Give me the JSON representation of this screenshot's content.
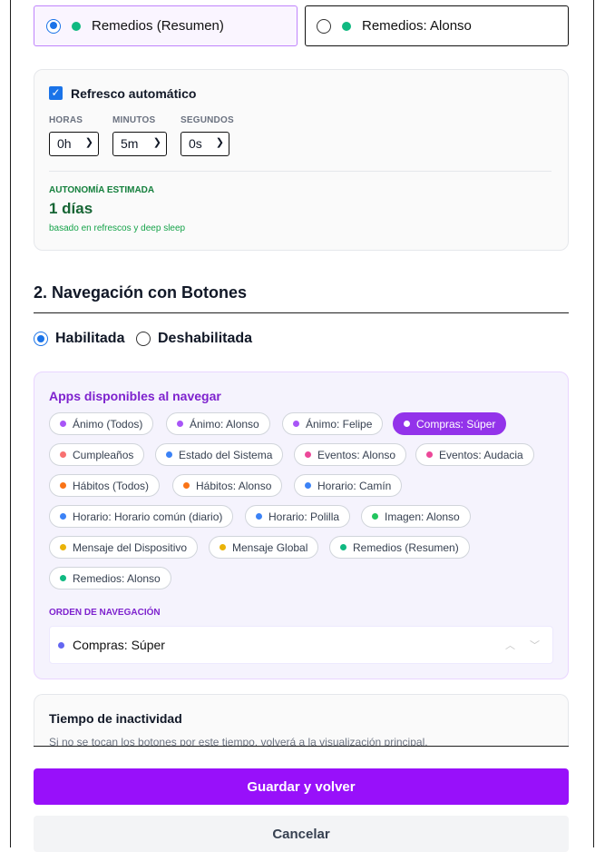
{
  "sources": [
    {
      "label": "Remedios (Resumen)",
      "selected": true,
      "dot_color": "#10b981"
    },
    {
      "label": "Remedios: Alonso",
      "selected": false,
      "dot_color": "#10b981"
    }
  ],
  "refresh": {
    "checkbox_label": "Refresco automático",
    "checked": true,
    "hours_label": "HORAS",
    "hours_value": "0h",
    "minutes_label": "MINUTOS",
    "minutes_value": "5m",
    "seconds_label": "SEGUNDOS",
    "seconds_value": "0s",
    "autonomy_label": "AUTONOMÍA ESTIMADA",
    "autonomy_value": "1 días",
    "autonomy_note": "basado en refrescos y deep sleep"
  },
  "navigation": {
    "title": "2. Navegación con Botones",
    "enabled_label": "Habilitada",
    "disabled_label": "Deshabilitada",
    "enabled": true,
    "apps_title": "Apps disponibles al navegar",
    "apps": [
      {
        "label": "Ánimo (Todos)",
        "color": "#a855f7",
        "active": false
      },
      {
        "label": "Ánimo: Alonso",
        "color": "#a855f7",
        "active": false
      },
      {
        "label": "Ánimo: Felipe",
        "color": "#a855f7",
        "active": false
      },
      {
        "label": "Compras: Súper",
        "color": "#ffffff",
        "active": true
      },
      {
        "label": "Cumpleaños",
        "color": "#f87171",
        "active": false
      },
      {
        "label": "Estado del Sistema",
        "color": "#3b82f6",
        "active": false
      },
      {
        "label": "Eventos: Alonso",
        "color": "#ec4899",
        "active": false
      },
      {
        "label": "Eventos: Audacia",
        "color": "#ec4899",
        "active": false
      },
      {
        "label": "Hábitos (Todos)",
        "color": "#f97316",
        "active": false
      },
      {
        "label": "Hábitos: Alonso",
        "color": "#f97316",
        "active": false
      },
      {
        "label": "Horario: Camín",
        "color": "#3b82f6",
        "active": false
      },
      {
        "label": "Horario: Horario común (diario)",
        "color": "#3b82f6",
        "active": false
      },
      {
        "label": "Horario: Polilla",
        "color": "#3b82f6",
        "active": false
      },
      {
        "label": "Imagen: Alonso",
        "color": "#22c55e",
        "active": false
      },
      {
        "label": "Mensaje del Dispositivo",
        "color": "#eab308",
        "active": false
      },
      {
        "label": "Mensaje Global",
        "color": "#eab308",
        "active": false
      },
      {
        "label": "Remedios (Resumen)",
        "color": "#10b981",
        "active": false
      },
      {
        "label": "Remedios: Alonso",
        "color": "#10b981",
        "active": false
      }
    ],
    "order_label": "ORDEN DE NAVEGACIÓN",
    "order_items": [
      {
        "label": "Compras: Súper",
        "color": "#6366f1"
      }
    ]
  },
  "idle": {
    "title": "Tiempo de inactividad",
    "description": "Si no se tocan los botones por este tiempo, volverá a la visualización principal."
  },
  "actions": {
    "save_label": "Guardar y volver",
    "cancel_label": "Cancelar"
  }
}
